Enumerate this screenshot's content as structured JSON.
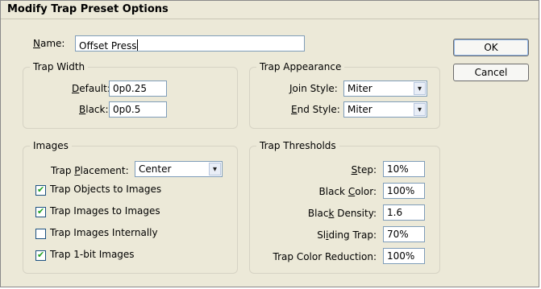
{
  "dialog": {
    "title": "Modify Trap Preset Options"
  },
  "name": {
    "label_pre": "",
    "label_u": "N",
    "label_post": "ame:",
    "value": "Offset Press"
  },
  "buttons": {
    "ok": "OK",
    "cancel": "Cancel"
  },
  "trap_width": {
    "title": "Trap Width",
    "default_label_u": "D",
    "default_label_post": "efault:",
    "default_value": "0p0.25",
    "black_label_u": "B",
    "black_label_post": "lack:",
    "black_value": "0p0.5"
  },
  "trap_appearance": {
    "title": "Trap Appearance",
    "join_label_u": "J",
    "join_label_post": "oin Style:",
    "join_value": "Miter",
    "end_label_u": "E",
    "end_label_post": "nd Style:",
    "end_value": "Miter"
  },
  "images": {
    "title": "Images",
    "placement_label_pre": "Trap ",
    "placement_label_u": "P",
    "placement_label_post": "lacement:",
    "placement_value": "Center",
    "checkboxes": [
      {
        "label": "Trap Objects to Images",
        "checked": true
      },
      {
        "label": "Trap Images to Images",
        "checked": true
      },
      {
        "label": "Trap Images Internally",
        "checked": false
      },
      {
        "label": "Trap 1-bit Images",
        "checked": true
      }
    ]
  },
  "thresholds": {
    "title": "Trap Thresholds",
    "step": {
      "pre": "",
      "u": "S",
      "post": "tep:",
      "value": "10%"
    },
    "black_color": {
      "pre": "Black ",
      "u": "C",
      "post": "olor:",
      "value": "100%"
    },
    "black_density": {
      "pre": "Blac",
      "u": "k",
      "post": " Density:",
      "value": "1.6"
    },
    "sliding_trap": {
      "pre": "Sl",
      "u": "i",
      "post": "ding Trap:",
      "value": "70%"
    },
    "color_reduction": {
      "pre": "Trap Color Reduction:",
      "u": "",
      "post": "",
      "value": "100%"
    }
  },
  "icons": {
    "checkmark": "✔",
    "dropdown_arrow": "▾"
  }
}
